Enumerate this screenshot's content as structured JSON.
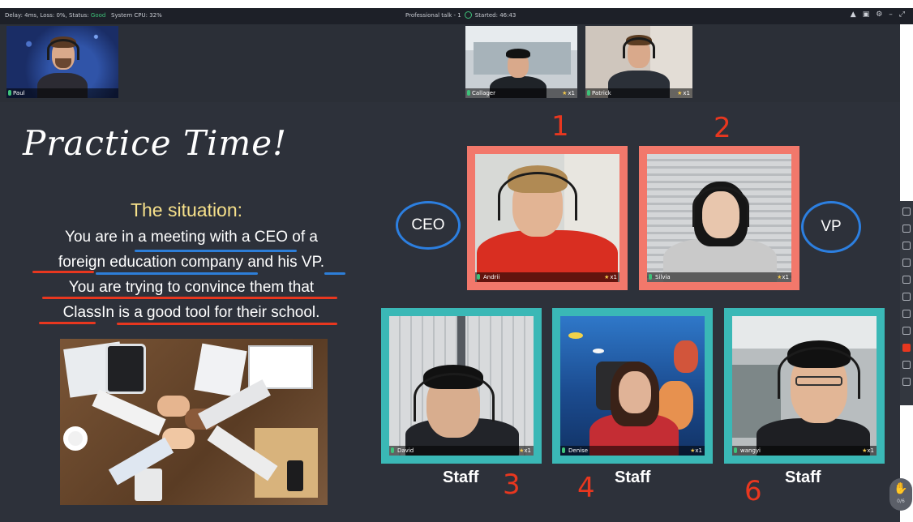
{
  "topbar": {
    "status_prefix": "Delay: 4ms, Loss: 0%, Status:",
    "status_value": "Good",
    "status_suffix": "System CPU: 32%",
    "session_title": "Professional talk - 1",
    "started": "Started: 46:43"
  },
  "video_strip": {
    "participants": [
      {
        "name": "Paul"
      },
      {
        "name": "Callager",
        "trophy_count": "x1"
      },
      {
        "name": "Patrick",
        "trophy_count": "x1"
      }
    ]
  },
  "slide": {
    "title": "Practice Time!",
    "situation_heading": "The situation:",
    "lines": [
      "You are in a meeting with a CEO of a",
      "foreign education company and his VP.",
      "You are trying to convince them that",
      "ClassIn is a good tool for their school."
    ]
  },
  "tiles": [
    {
      "name": "Andrii",
      "trophy_count": "x1",
      "border_color": "#f2786b"
    },
    {
      "name": "Silvia",
      "trophy_count": "x1",
      "border_color": "#f2786b"
    },
    {
      "name": "David",
      "trophy_count": "x1",
      "border_color": "#3ab8b6"
    },
    {
      "name": "Denise",
      "trophy_count": "x1",
      "border_color": "#3ab8b6"
    },
    {
      "name": "wangyi",
      "trophy_count": "x1",
      "border_color": "#3ab8b6"
    }
  ],
  "annotations": {
    "ceo": "CEO",
    "vp": "VP",
    "staff": "Staff",
    "numbers": [
      "1",
      "2",
      "3",
      "4",
      "6"
    ]
  },
  "hand_raise": {
    "icon": "hand-icon",
    "count": "0/6"
  },
  "colors": {
    "accent_red": "#e8371f",
    "accent_blue": "#2d7ed8",
    "good_green": "#3ec27a"
  }
}
